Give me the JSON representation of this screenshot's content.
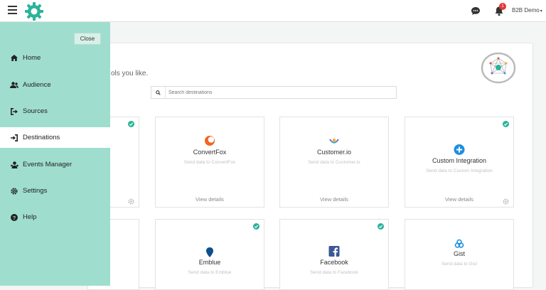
{
  "topbar": {
    "menu_icon": "hamburger-icon",
    "logo_icon": "gear-logo-icon",
    "chat_icon": "chat-icon",
    "bell_icon": "bell-icon",
    "notification_count": "1",
    "user_label": "B2B Demo",
    "caret": "▾",
    "brand_color": "#2bb39a"
  },
  "sidebar": {
    "close_label": "Close",
    "items": [
      {
        "label": "Home",
        "icon": "home-icon",
        "active": false
      },
      {
        "label": "Audience",
        "icon": "users-icon",
        "active": false
      },
      {
        "label": "Sources",
        "icon": "sign-in-icon",
        "active": false
      },
      {
        "label": "Destinations",
        "icon": "sign-out-icon",
        "active": true
      },
      {
        "label": "Events Manager",
        "icon": "user-group-icon",
        "active": false
      },
      {
        "label": "Settings",
        "icon": "gear-icon",
        "active": false
      },
      {
        "label": "Help",
        "icon": "question-icon",
        "active": false
      }
    ],
    "bg_color": "#9fdece"
  },
  "main": {
    "intro_text": "ols you like.",
    "search_placeholder": "Search destinations",
    "hub_icon": "hub-network-icon"
  },
  "cards": [
    {
      "name": "",
      "desc": "",
      "details": "",
      "connected": true,
      "icon": ""
    },
    {
      "name": "ConvertFox",
      "desc": "Send data to ConvertFox",
      "details": "View details",
      "connected": false,
      "icon": "convertfox-icon"
    },
    {
      "name": "Customer.io",
      "desc": "Send data to Customer.io",
      "details": "View details",
      "connected": false,
      "icon": "customerio-icon"
    },
    {
      "name": "Custom Integration",
      "desc": "Send data to Custom Integration",
      "details": "View details",
      "connected": true,
      "icon": "plus-circle-icon"
    },
    {
      "name": "Emblue",
      "desc": "Send data to Emblue",
      "details": "",
      "connected": true,
      "icon": "emblue-icon"
    },
    {
      "name": "Facebook",
      "desc": "Send data to Facebook",
      "details": "",
      "connected": true,
      "icon": "facebook-icon"
    },
    {
      "name": "Gist",
      "desc": "Send data to Gist",
      "details": "",
      "connected": false,
      "icon": "gist-icon"
    }
  ]
}
